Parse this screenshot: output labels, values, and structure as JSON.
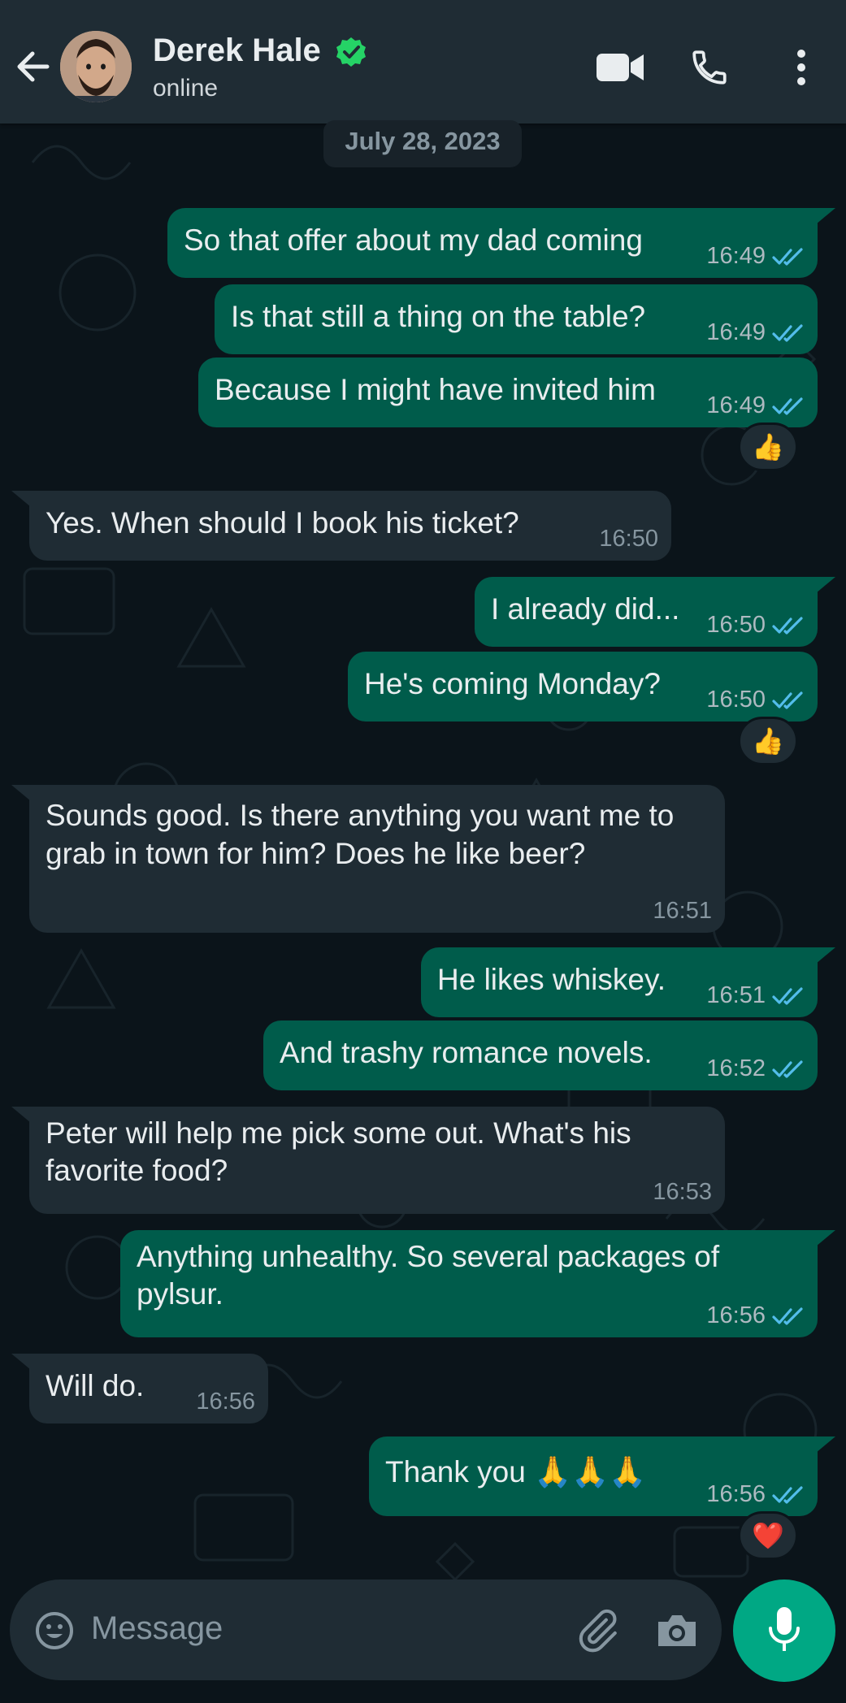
{
  "header": {
    "contact_name": "Derek Hale",
    "status": "online",
    "icons": [
      "back-arrow-icon",
      "verified-badge-icon",
      "video-call-icon",
      "voice-call-icon",
      "more-options-icon"
    ]
  },
  "date_label": "July 28, 2023",
  "messages": [
    {
      "direction": "out",
      "text": "So that offer about my dad coming",
      "time": "16:49",
      "status": "read"
    },
    {
      "direction": "out",
      "text": "Is that still a thing on the table?",
      "time": "16:49",
      "status": "read"
    },
    {
      "direction": "out",
      "text": "Because I might have invited him",
      "time": "16:49",
      "status": "read",
      "reaction": "👍"
    },
    {
      "direction": "in",
      "text": "Yes. When should I book his ticket?",
      "time": "16:50"
    },
    {
      "direction": "out",
      "text": "I already did...",
      "time": "16:50",
      "status": "read"
    },
    {
      "direction": "out",
      "text": "He's coming Monday?",
      "time": "16:50",
      "status": "read",
      "reaction": "👍"
    },
    {
      "direction": "in",
      "text": "Sounds good. Is there anything you want me to grab in town for him? Does he like beer?",
      "time": "16:51"
    },
    {
      "direction": "out",
      "text": "He likes whiskey.",
      "time": "16:51",
      "status": "read"
    },
    {
      "direction": "out",
      "text": "And trashy romance novels.",
      "time": "16:52",
      "status": "read"
    },
    {
      "direction": "in",
      "text": "Peter will help me pick some out. What's his favorite food?",
      "time": "16:53"
    },
    {
      "direction": "out",
      "text": "Anything unhealthy. So several packages of pylsur.",
      "time": "16:56",
      "status": "read"
    },
    {
      "direction": "in",
      "text": "Will do.",
      "time": "16:56"
    },
    {
      "direction": "out",
      "text": "Thank you 🙏🙏🙏",
      "time": "16:56",
      "status": "read",
      "reaction": "❤️"
    }
  ],
  "composer": {
    "placeholder": "Message",
    "icons": [
      "emoji-icon",
      "attach-icon",
      "camera-icon",
      "microphone-icon"
    ]
  },
  "colors": {
    "header_bg": "#1f2c34",
    "chat_bg": "#0b141a",
    "outgoing_bubble": "#005c4b",
    "incoming_bubble": "#1f2c34",
    "read_ticks": "#53bdeb",
    "accent": "#00a884"
  }
}
